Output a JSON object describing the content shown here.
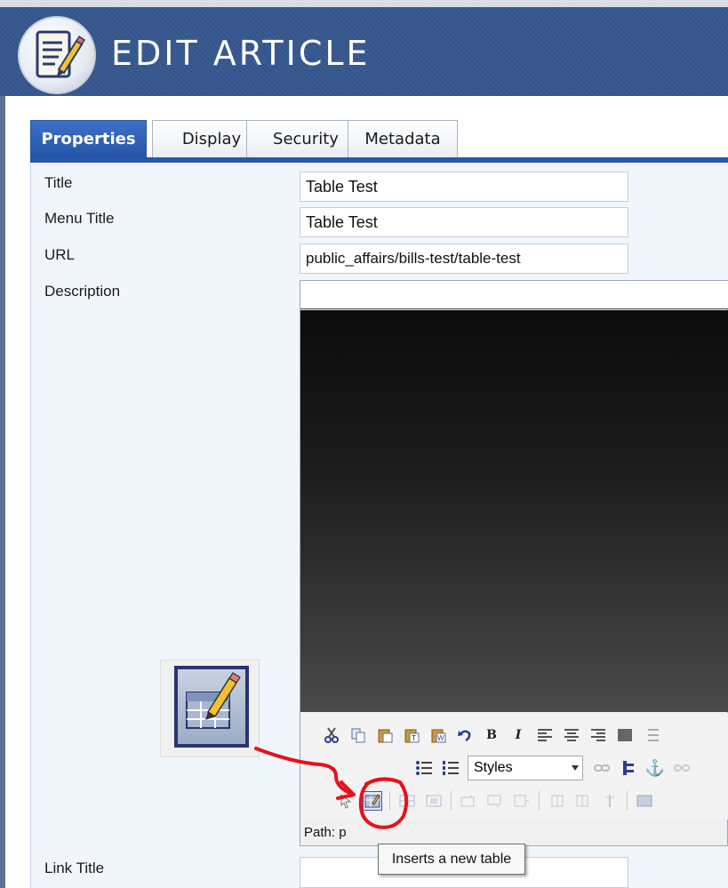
{
  "header": {
    "title": "EDIT ARTICLE"
  },
  "tabs": [
    {
      "label": "Properties",
      "active": true
    },
    {
      "label": "Display",
      "active": false
    },
    {
      "label": "Security",
      "active": false
    },
    {
      "label": "Metadata",
      "active": false
    }
  ],
  "form": {
    "title_label": "Title",
    "title_value": "Table Test",
    "menu_title_label": "Menu Title",
    "menu_title_value": "Table Test",
    "url_label": "URL",
    "url_value": "public_affairs/bills-test/table-test",
    "description_label": "Description",
    "link_title_label": "Link Title",
    "link_title_value": ""
  },
  "editor": {
    "styles_value": "Styles",
    "path_label": "Path: p"
  },
  "tooltip": {
    "text": "Inserts a new table"
  },
  "colors": {
    "header_bg": "#3a5c92",
    "tab_active": "#2b57a6",
    "panel_bg": "#f1f6fc",
    "annotation": "#e8101a"
  }
}
